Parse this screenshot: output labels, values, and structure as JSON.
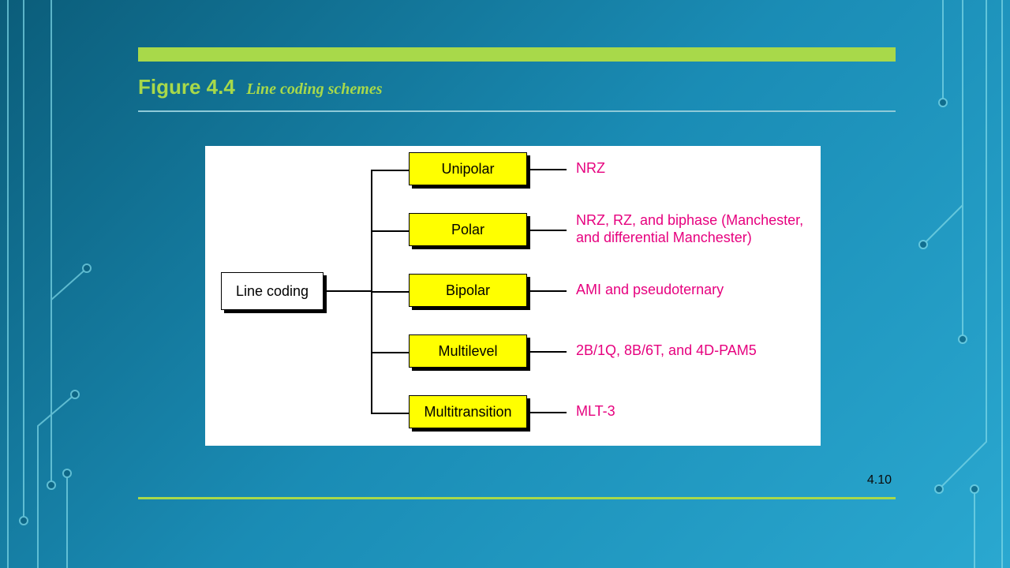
{
  "title_prefix": "Figure 4.4",
  "title_sub": "Line coding schemes",
  "page_number": "4.10",
  "root_label": "Line coding",
  "branches": [
    {
      "label": "Unipolar",
      "desc": "NRZ"
    },
    {
      "label": "Polar",
      "desc": "NRZ, RZ, and biphase (Manchester, and differential Manchester)"
    },
    {
      "label": "Bipolar",
      "desc": "AMI and pseudoternary"
    },
    {
      "label": "Multilevel",
      "desc": "2B/1Q,  8B/6T, and 4D-PAM5"
    },
    {
      "label": "Multitransition",
      "desc": "MLT-3"
    }
  ]
}
